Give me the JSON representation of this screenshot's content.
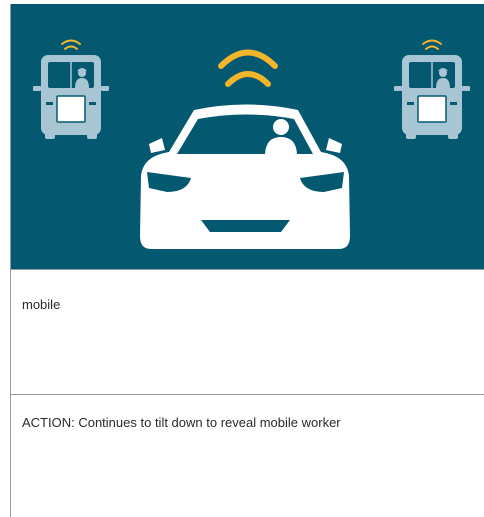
{
  "panel": {
    "background_color": "#045970",
    "signal_color": "#f3b62b",
    "car_color": "#ffffff",
    "truck_color": "#a8c5d3",
    "icons": [
      "connected-car-icon",
      "utility-truck-icon",
      "utility-truck-icon",
      "wireless-signal-icon"
    ]
  },
  "rows": {
    "caption": "mobile",
    "action": "ACTION: Continues to tilt down to reveal mobile worker"
  }
}
